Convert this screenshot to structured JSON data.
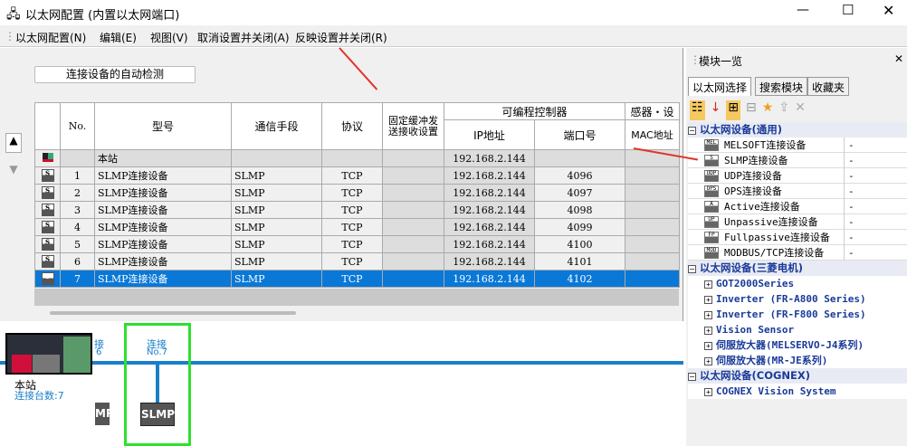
{
  "window": {
    "title": "以太网配置 (内置以太网端口)"
  },
  "menu": [
    "以太网配置(N)",
    "编辑(E)",
    "视图(V)",
    "取消设置并关闭(A)",
    "反映设置并关闭(R)"
  ],
  "detect_button": "连接设备的自动检测",
  "table": {
    "headers": {
      "no": "No.",
      "model": "型号",
      "comm": "通信手段",
      "protocol": "协议",
      "fixed": "固定缓冲发送接收设置",
      "plc": "可编程控制器",
      "ip": "IP地址",
      "port": "端口号",
      "sensor": "感器・设",
      "mac": "MAC地址"
    },
    "station": {
      "model": "本站",
      "ip": "192.168.2.144"
    },
    "rows": [
      {
        "no": "1",
        "model": "SLMP连接设备",
        "comm": "SLMP",
        "protocol": "TCP",
        "ip": "192.168.2.144",
        "port": "4096"
      },
      {
        "no": "2",
        "model": "SLMP连接设备",
        "comm": "SLMP",
        "protocol": "TCP",
        "ip": "192.168.2.144",
        "port": "4097"
      },
      {
        "no": "3",
        "model": "SLMP连接设备",
        "comm": "SLMP",
        "protocol": "TCP",
        "ip": "192.168.2.144",
        "port": "4098"
      },
      {
        "no": "4",
        "model": "SLMP连接设备",
        "comm": "SLMP",
        "protocol": "TCP",
        "ip": "192.168.2.144",
        "port": "4099"
      },
      {
        "no": "5",
        "model": "SLMP连接设备",
        "comm": "SLMP",
        "protocol": "TCP",
        "ip": "192.168.2.144",
        "port": "4100"
      },
      {
        "no": "6",
        "model": "SLMP连接设备",
        "comm": "SLMP",
        "protocol": "TCP",
        "ip": "192.168.2.144",
        "port": "4101"
      },
      {
        "no": "7",
        "model": "SLMP连接设备",
        "comm": "SLMP",
        "protocol": "TCP",
        "ip": "192.168.2.144",
        "port": "4102"
      }
    ]
  },
  "diagram": {
    "station": "本站",
    "count": "连接台数:7",
    "prev_label": "接",
    "prev_no": "6",
    "conn_label": "连接",
    "conn_no": "No.7",
    "slmp": "SLMP",
    "slmp_partial": "MP"
  },
  "panel": {
    "title": "模块一览",
    "tabs": [
      "以太网选择",
      "搜索模块",
      "收藏夹"
    ],
    "groups": [
      {
        "label": "以太网设备(通用)",
        "items": [
          {
            "icon": "MEL",
            "label": "MELSOFT连接设备",
            "value": "-"
          },
          {
            "icon": "S",
            "label": "SLMP连接设备",
            "value": "-"
          },
          {
            "icon": "UDP",
            "label": "UDP连接设备",
            "value": "-"
          },
          {
            "icon": "OPS",
            "label": "OPS连接设备",
            "value": "-"
          },
          {
            "icon": "A",
            "label": "Active连接设备",
            "value": "-"
          },
          {
            "icon": "UP",
            "label": "Unpassive连接设备",
            "value": "-"
          },
          {
            "icon": "FP",
            "label": "Fullpassive连接设备",
            "value": "-"
          },
          {
            "icon": "MOD",
            "label": "MODBUS/TCP连接设备",
            "value": "-"
          }
        ]
      },
      {
        "label": "以太网设备(三菱电机)",
        "subs": [
          "GOT2000Series",
          "Inverter (FR-A800 Series)",
          "Inverter (FR-F800 Series)",
          "Vision Sensor",
          "伺服放大器(MELSERVO-J4系列)",
          "伺服放大器(MR-JE系列)"
        ]
      },
      {
        "label": "以太网设备(COGNEX)",
        "subs": [
          "COGNEX Vision System"
        ]
      }
    ]
  }
}
